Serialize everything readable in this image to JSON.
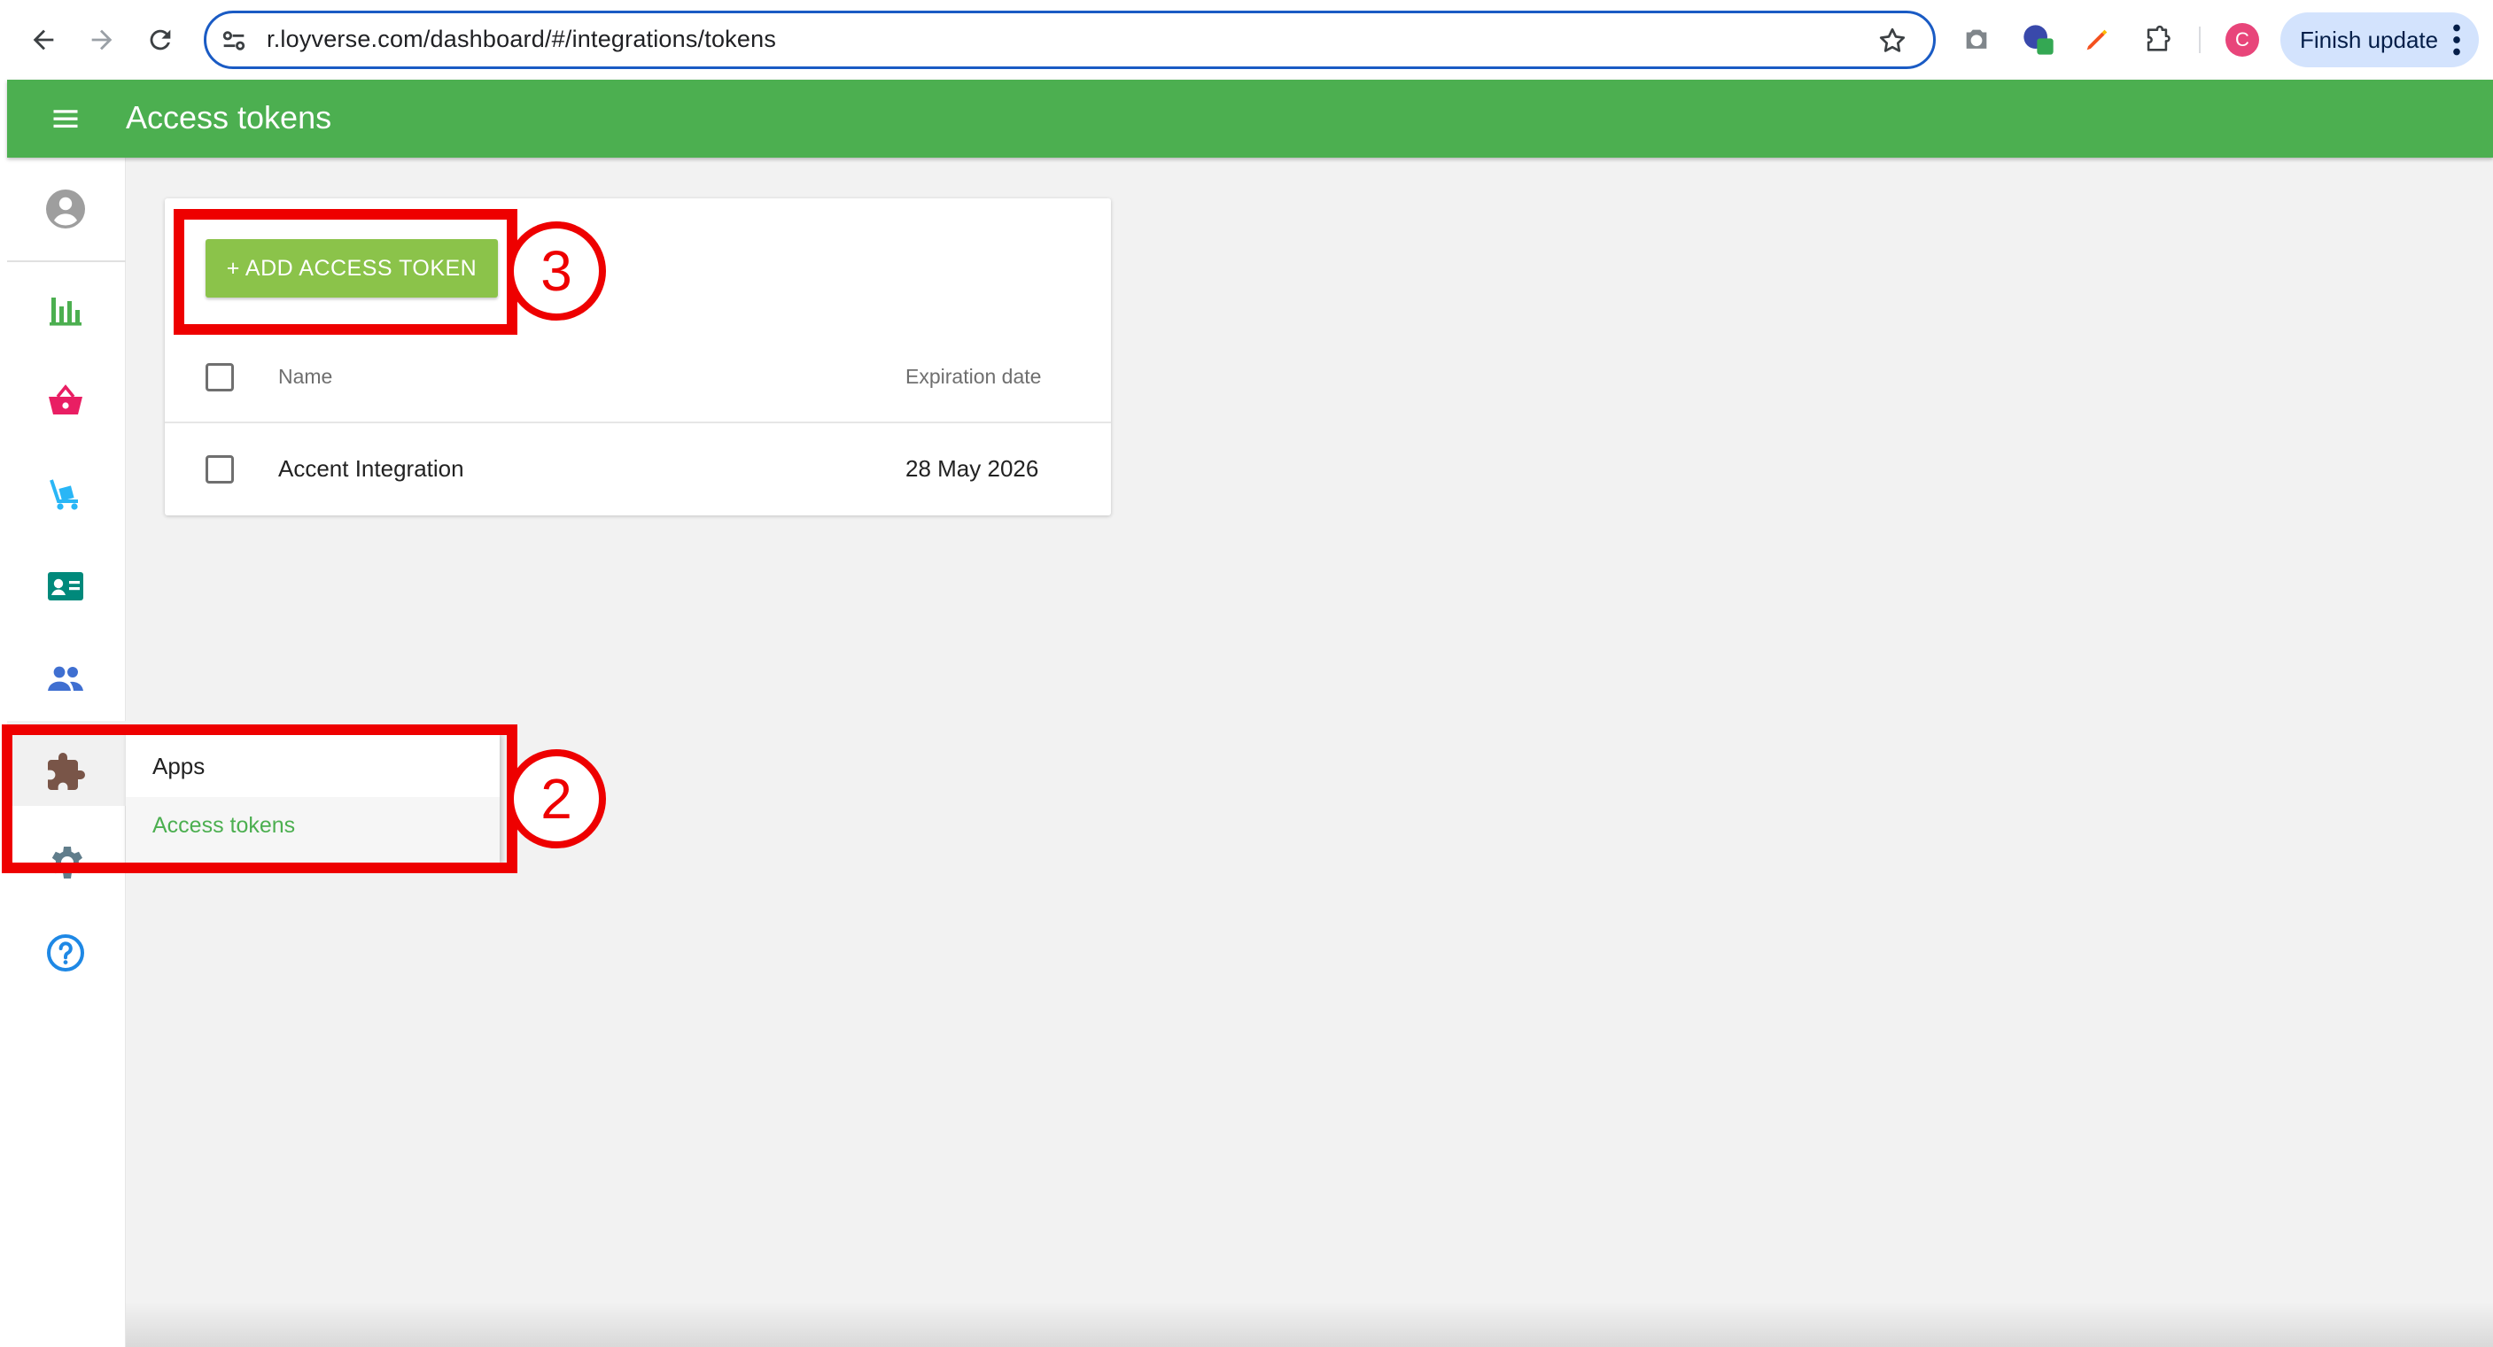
{
  "browser": {
    "url": "r.loyverse.com/dashboard/#/integrations/tokens",
    "profile_initial": "C",
    "finish_update_label": "Finish update"
  },
  "header": {
    "title": "Access tokens"
  },
  "sidebar": {
    "items": [
      {
        "name": "account-icon",
        "color": "#9e9e9e"
      },
      {
        "name": "reports-icon",
        "color": "#4caf50"
      },
      {
        "name": "items-icon",
        "color": "#e91e63"
      },
      {
        "name": "inventory-icon",
        "color": "#29b6f6"
      },
      {
        "name": "customers-icon",
        "color": "#00897b"
      },
      {
        "name": "employees-icon",
        "color": "#3f6fd1"
      },
      {
        "name": "integrations-icon",
        "color": "#795548"
      },
      {
        "name": "settings-icon",
        "color": "#607d8b"
      },
      {
        "name": "help-icon",
        "color": "#1e88e5"
      }
    ]
  },
  "submenu": {
    "title": "Apps",
    "items": [
      {
        "label": "Access tokens",
        "active": true
      }
    ]
  },
  "card": {
    "add_button_label": "+ ADD ACCESS TOKEN",
    "columns": [
      "Name",
      "Expiration date"
    ],
    "rows": [
      {
        "name": "Accent Integration",
        "expiration": "28 May 2026"
      }
    ]
  },
  "annotations": {
    "step_two": "2",
    "step_three": "3",
    "color": "#ee0000"
  },
  "colors": {
    "appbar": "#4caf50",
    "add_button": "#8bc34a",
    "omnibox_border": "#1a5bc4"
  }
}
